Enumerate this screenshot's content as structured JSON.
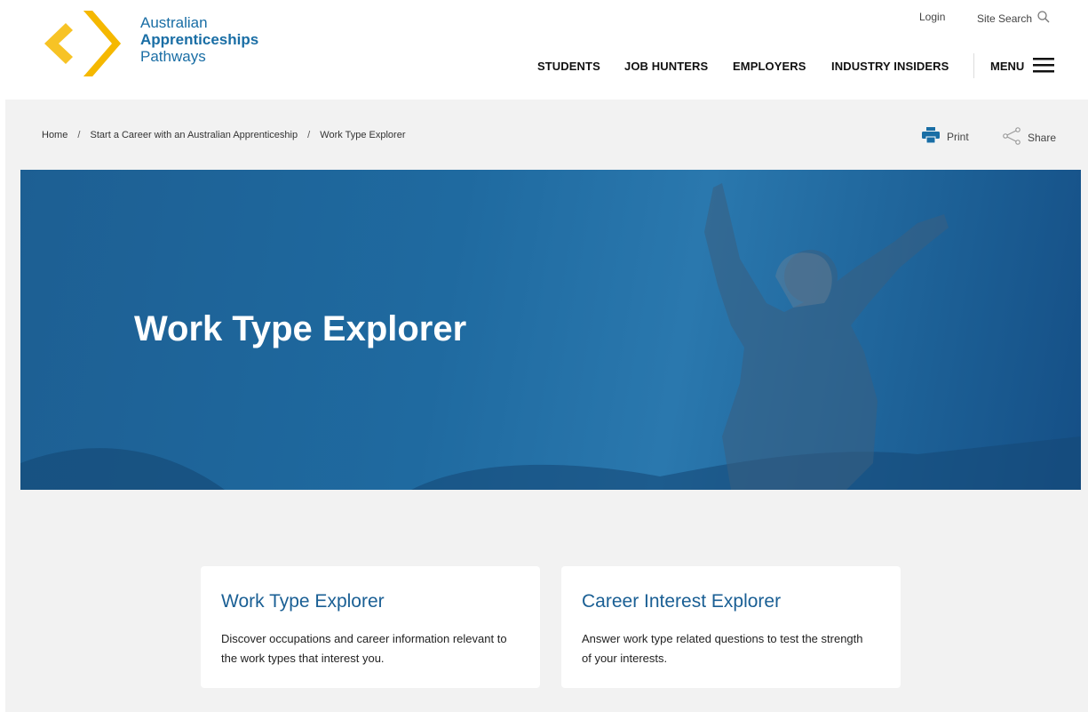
{
  "brand": {
    "line1": "Australian",
    "line2": "Apprenticeships",
    "line3": "Pathways",
    "logo_color": "#f7c325",
    "text_color": "#1a6ea5"
  },
  "utility": {
    "login": "Login",
    "site_search": "Site Search",
    "search_icon": "search-icon"
  },
  "nav": {
    "items": [
      "STUDENTS",
      "JOB HUNTERS",
      "EMPLOYERS",
      "INDUSTRY INSIDERS"
    ],
    "menu_label": "MENU",
    "menu_icon": "hamburger-icon"
  },
  "breadcrumb": {
    "items": [
      "Home",
      "Start a Career with an Australian Apprenticeship",
      "Work Type Explorer"
    ],
    "separator": "/"
  },
  "actions": {
    "print": "Print",
    "share": "Share",
    "print_icon": "printer-icon",
    "share_icon": "share-icon"
  },
  "hero": {
    "title": "Work Type Explorer",
    "image": "person-arms-raised-silhouette",
    "color": "#1d6399"
  },
  "cards": [
    {
      "title": "Work Type Explorer",
      "description": "Discover occupations and career information relevant to the work types that interest you."
    },
    {
      "title": "Career Interest Explorer",
      "description": "Answer work type related questions to test the strength of your interests."
    }
  ],
  "colors": {
    "accent": "#1a5f94",
    "background": "#f2f2f2",
    "card": "#ffffff"
  }
}
